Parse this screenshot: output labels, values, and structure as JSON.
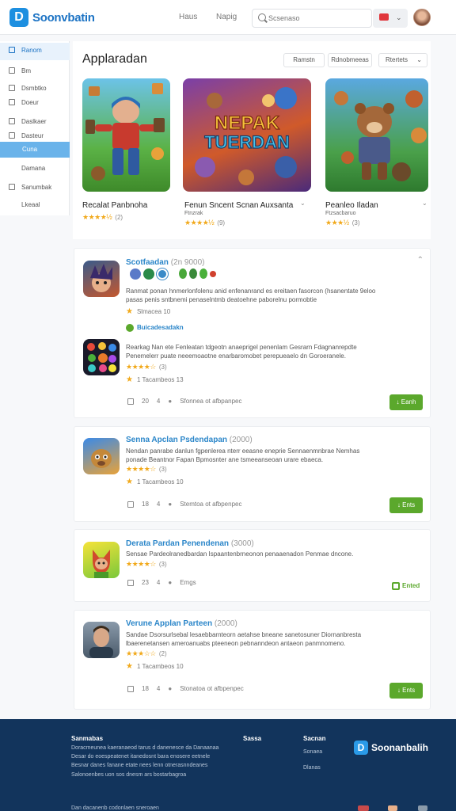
{
  "header": {
    "logo_mark": "D",
    "logo_text": "Soonvbatin",
    "nav": [
      "Haus",
      "Napig"
    ],
    "search_placeholder": "Scsenaso"
  },
  "sidebar": {
    "items": [
      {
        "label": "Ranom",
        "state": "active"
      },
      {
        "label": "Bm",
        "state": "normal"
      },
      {
        "label": "Dsmbtko",
        "state": "normal"
      },
      {
        "label": "Doeur",
        "state": "normal"
      },
      {
        "label": "Daslkaer",
        "state": "normal"
      },
      {
        "label": "Dasteur",
        "state": "normal"
      },
      {
        "label": "Cuna",
        "state": "selected"
      },
      {
        "label": "Damana",
        "state": "normal"
      },
      {
        "label": "Sanumbak",
        "state": "normal"
      },
      {
        "label": "Lkeaal",
        "state": "normal"
      }
    ]
  },
  "featured": {
    "title": "Applaradan",
    "buttons": [
      "Ramstn",
      "Rdnobmeeas",
      "Rtertets"
    ],
    "cards": [
      {
        "name": "Recalat Panbnoha",
        "rating_stars": "★★★★½",
        "rating_value": "(2)"
      },
      {
        "name": "Fenun Sncent Scnan Auxsanta",
        "rating_stars": "★★★★½",
        "rating_value": "(9)",
        "tag": "Ftnzrak"
      },
      {
        "name": "Peanleo Iladan",
        "rating_stars": "★★★½",
        "rating_value": "(3)",
        "tag": "Ftzsacbaruo"
      }
    ],
    "art_text_1": "NEPAK",
    "art_text_2": "TUERDAN"
  },
  "entries": [
    {
      "title": "Scotfaadan",
      "title_paren": "(2n 9000)",
      "desc": "Ranmat ponan hnmerlonfolenu anid enfenanrand es ereitaen fasorcon (hsanentate 9eloo pasas penis sntbnemi penaselntmb deatoehne paborelnu pormobtie",
      "meta": "Slmacea 10",
      "tag": "Buicadesadakn",
      "app2_desc": "Rearkag Nan ete Fenleatan tdgeotn anaeprigel penenlam Gesrarn Fdagnanrepdte Penemelerr puate neeemoaotne enarbaromobet perepueaelo dn Goroeranele.",
      "app2_stars": "★★★★☆",
      "app2_rating": "(3)",
      "app2_meta": "1 Tacambeos 13",
      "foot": [
        "20",
        "4",
        "Sfonnea ot afbpanpec"
      ],
      "button": "Eanh"
    },
    {
      "title": "Senna Apclan Psdendapan",
      "title_paren": "(2000)",
      "desc": "Nendan panrabe danlun fgpenlerea nterr eeasne eneprie Sennaenmnbrae Nemhas ponade Beantnor Fapan Bpmosnter ane tsmeeanseoan urare ebaeca.",
      "stars": "★★★★☆",
      "rating": "(3)",
      "meta": "1 Tacambeos 10",
      "foot": [
        "18",
        "4",
        "Stemtoa ot afbpenpec"
      ],
      "button": "Ents"
    },
    {
      "title": "Derata Pardan Penendenan",
      "title_paren": "(3000)",
      "desc": "Sensae Pardeolranedbardan Ispaantenbrneonon penaaenadon Penmae dncone.",
      "stars": "★★★★☆",
      "rating": "(3)",
      "foot": [
        "23",
        "4",
        "Emgs"
      ],
      "button": "Ented"
    },
    {
      "title": "Verune Applan Parteen",
      "title_paren": "(2000)",
      "desc": "Sandae Dsorsurlsebal lesaebbarnteorn aetahse bneane sanetosuner Diornanbresta lbaerenetansen ameroanuabs pteeneon pebnanndeon antaeon panmnomeno.",
      "stars": "★★★☆☆",
      "rating": "(2)",
      "meta": "1 Tacambeos 10",
      "foot": [
        "18",
        "4",
        "Stonatoa ot afbpenpec"
      ],
      "button": "Ents"
    }
  ],
  "footer": {
    "col1_title": "Sanmabas",
    "col1_links": [
      "Doracmeunea kaeranaeod tarus d danenesce da Danaanaa",
      "Desar do eoespeatenet itanedosnt bara enosere eetnele",
      "Besnar danes fanane etate nees lenn otnerasnndeanes",
      "Salonoenbes uon sos dnesm ars bostarbagroa"
    ],
    "col2_title": "Sassa",
    "col3_title": "Sacnan",
    "col3_links": [
      "Sonaea",
      "Dlanas"
    ],
    "logo_mark": "D",
    "logo_text": "Soonanbalih",
    "copyright": "Dan dacanenb codonlaen sneroaen"
  }
}
